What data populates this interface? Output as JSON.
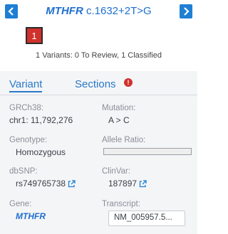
{
  "header": {
    "gene": "MTHFR",
    "variant": "c.1632+2T>G",
    "badge_count": "1",
    "summary": "1 Variants: 0 To Review, 1 Classified"
  },
  "tabs": {
    "variant": "Variant",
    "sections": "Sections",
    "sections_alert": "!"
  },
  "fields": {
    "build_label": "GRCh38:",
    "build_value": "chr1: 11,792,276",
    "mutation_label": "Mutation:",
    "mutation_value": "A > C",
    "genotype_label": "Genotype:",
    "genotype_value": "Homozygous",
    "allele_ratio_label": "Allele Ratio:",
    "dbsnp_label": "dbSNP:",
    "dbsnp_value": "rs749765738",
    "clinvar_label": "ClinVar:",
    "clinvar_value": "187897",
    "gene_label": "Gene:",
    "gene_value": "MTHFR",
    "transcript_label": "Transcript:",
    "transcript_value": "NM_005957.5..."
  },
  "colors": {
    "accent": "#1f7fd4",
    "badge": "#d0312d",
    "link": "#1f6fd0"
  },
  "icons": {
    "prev": "chevron-left-icon",
    "next": "chevron-right-icon",
    "external": "external-link-icon"
  }
}
